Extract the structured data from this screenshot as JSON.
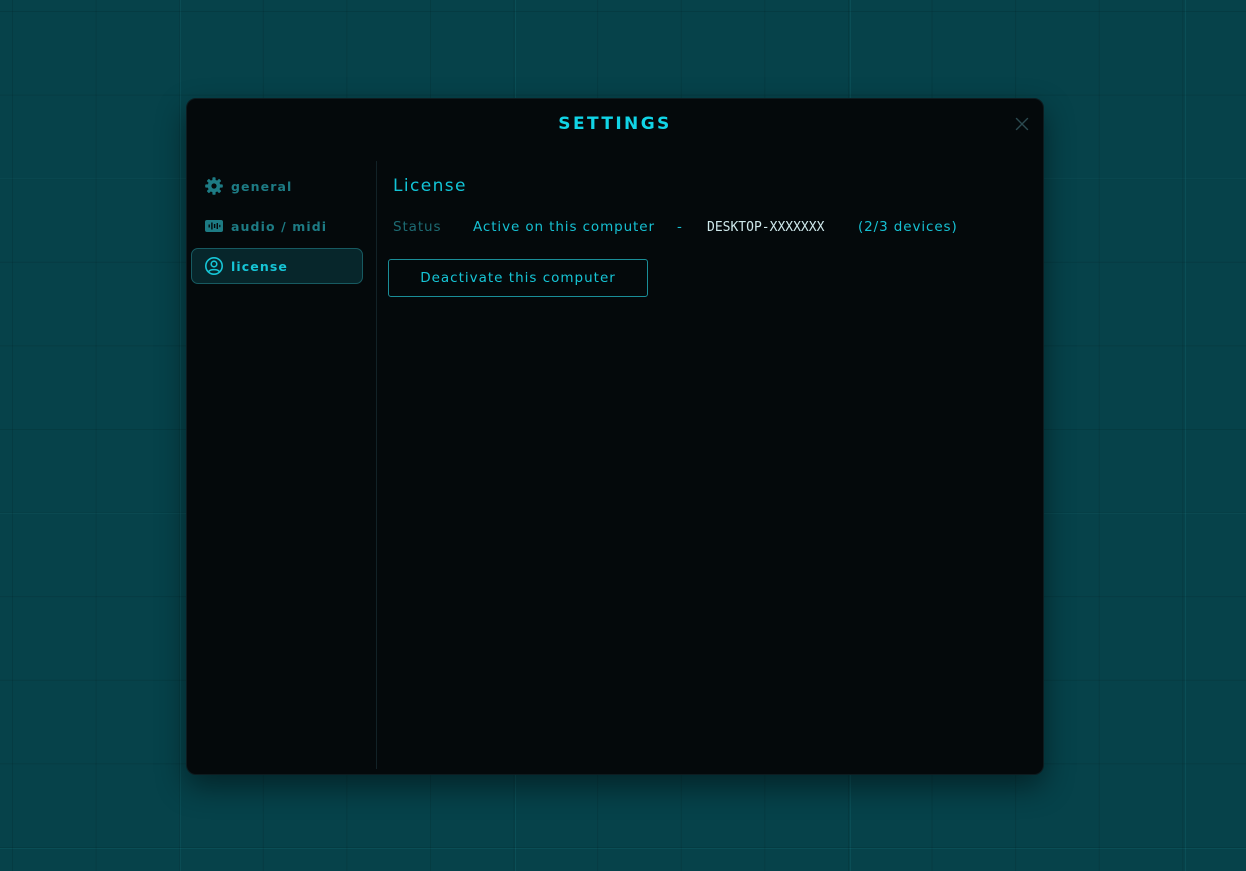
{
  "modal": {
    "title": "SETTINGS",
    "close_icon": "close-icon"
  },
  "sidebar": {
    "items": [
      {
        "label": "general",
        "icon": "gear-icon",
        "active": false
      },
      {
        "label": "audio / midi",
        "icon": "audio-wave-icon",
        "active": false
      },
      {
        "label": "license",
        "icon": "user-circle-icon",
        "active": true
      }
    ]
  },
  "license": {
    "title": "License",
    "status_label": "Status",
    "status_value": "Active on this computer",
    "separator": "-",
    "device_name": "DESKTOP-XXXXXXX",
    "device_count": "(2/3 devices)",
    "deactivate_label": "Deactivate this computer"
  },
  "colors": {
    "accent": "#11d4e6",
    "accent_dim": "#1d7b84",
    "panel_bg": "#04090b",
    "page_bg": "#06424a",
    "active_item_bg": "#07262b"
  }
}
